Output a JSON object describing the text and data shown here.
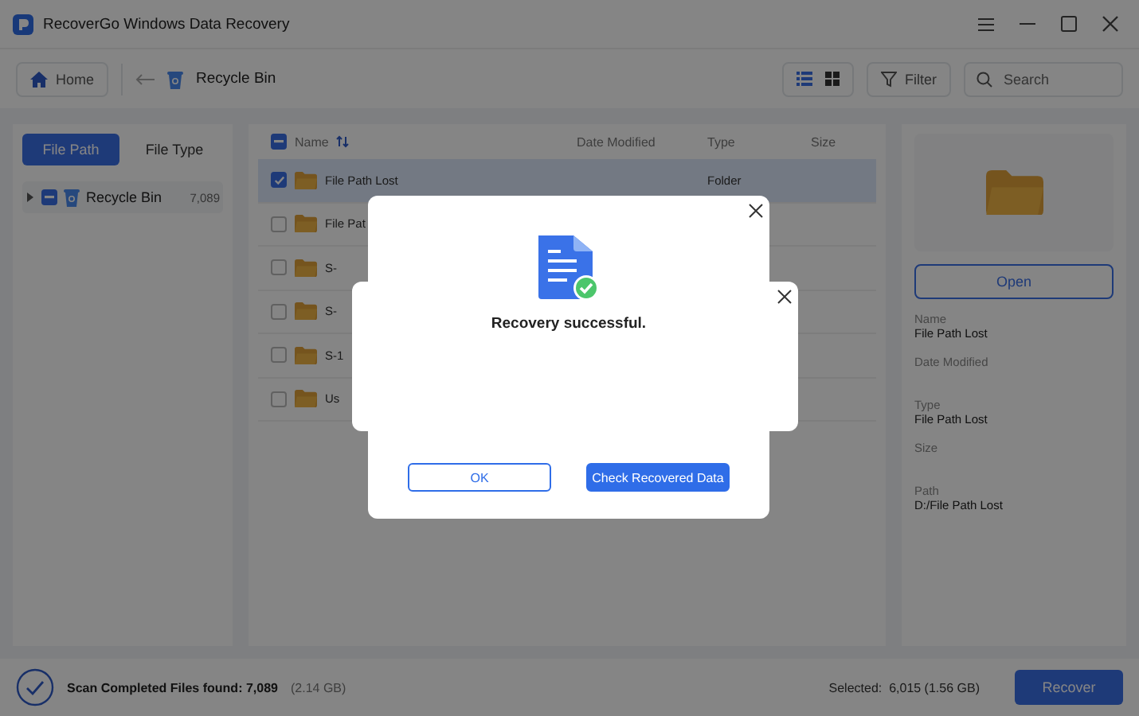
{
  "window": {
    "title": "RecoverGo Windows Data Recovery"
  },
  "toolbar": {
    "home": "Home",
    "location": "Recycle Bin",
    "view_modes": [
      {
        "kind": "list",
        "selected": true
      },
      {
        "kind": "grid",
        "selected": false
      }
    ],
    "filter": "Filter",
    "search": {
      "placeholder": "Search"
    }
  },
  "sidebar": {
    "tabs": [
      {
        "label": "File Path",
        "selected": true
      },
      {
        "label": "File Type",
        "selected": false
      }
    ],
    "tree": [
      {
        "label": "Recycle Bin",
        "count": "7,089",
        "expanded": false,
        "indeterminate": true
      }
    ]
  },
  "table": {
    "select_all": {
      "indeterminate": true
    },
    "columns": [
      "Name",
      "Date Modified",
      "Type",
      "Size"
    ],
    "rows": [
      {
        "name": "File Path Lost",
        "type": "Folder",
        "selected": true,
        "checked": true
      },
      {
        "name": "File Pat",
        "selected": false,
        "checked": false
      },
      {
        "name": "S-",
        "selected": false,
        "checked": false
      },
      {
        "name": "S-",
        "selected": false,
        "checked": false
      },
      {
        "name": "S-1",
        "selected": false,
        "checked": false
      },
      {
        "name": "Us",
        "selected": false,
        "checked": false
      }
    ]
  },
  "details": {
    "button": "Open",
    "fields": [
      {
        "label": "Name",
        "value": "File Path Lost"
      },
      {
        "label": "Date Modified"
      },
      {
        "label": "Type",
        "value": "File Path Lost"
      },
      {
        "label": "Size"
      },
      {
        "label": "Path",
        "value": "D:/File Path Lost"
      }
    ]
  },
  "status_bar": {
    "summary": "Scan Completed Files found: 7,089",
    "size": "(2.14 GB)",
    "selected": "Selected:  6,015 (1.56 GB)",
    "recover_button": "Recover"
  },
  "dialog": {
    "title": "Recovery successful.",
    "buttons": [
      {
        "label": "OK",
        "kind": "secondary"
      },
      {
        "label": "Check Recovered Data",
        "kind": "primary"
      }
    ]
  }
}
